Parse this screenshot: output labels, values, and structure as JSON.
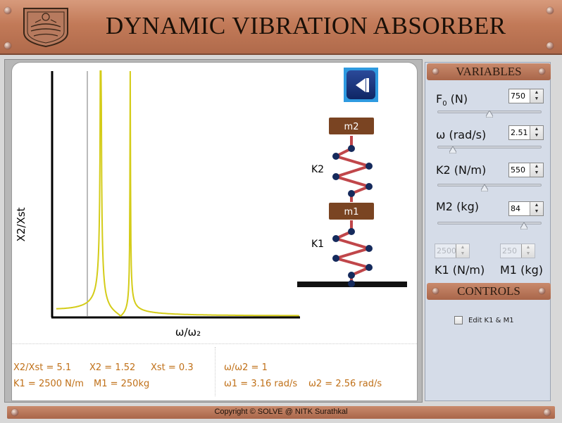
{
  "app": {
    "title": "DYNAMIC VIBRATION ABSORBER"
  },
  "plot": {
    "ylabel": "X2/Xst",
    "xlabel": "ω/ω₂"
  },
  "schematic": {
    "mass_top": "m2",
    "mass_bottom": "m1",
    "spring_top": "K2",
    "spring_bottom": "K1"
  },
  "readouts": {
    "ratio": "X2/Xst = 5.1",
    "x2": "X2 = 1.52",
    "xst": "Xst = 0.3",
    "k1": "K1 = 2500 N/m",
    "m1": "M1 = 250kg",
    "freq_ratio": "ω/ω2 = 1",
    "w1": "ω1 = 3.16 rad/s",
    "w2": "ω2 = 2.56 rad/s"
  },
  "variables": {
    "header": "VARIABLES",
    "f0": {
      "label_main": "F",
      "label_sub": "0",
      "label_unit": " (N)",
      "value": "750",
      "slider_fraction": 0.5
    },
    "omega": {
      "label": "ω (rad/s)",
      "value": "2.51",
      "slider_fraction": 0.15
    },
    "k2": {
      "label": "K2 (N/m)",
      "value": "550",
      "slider_fraction": 0.45
    },
    "m2": {
      "label": "M2 (kg)",
      "value": "84",
      "slider_fraction": 0.83
    },
    "k1": {
      "label": "K1 (N/m)",
      "value": "2500"
    },
    "m1": {
      "label": "M1 (kg)",
      "value": "250"
    }
  },
  "controls": {
    "header": "CONTROLS",
    "edit_label": "Edit K1 & M1",
    "edit_checked": false
  },
  "footer": {
    "text": "Copyright © SOLVE @ NITK Surathkal"
  },
  "colors": {
    "curve": "#d4cc18",
    "readout": "#c07018",
    "spring": "#c0464a",
    "mass": "#7a4422",
    "node": "#152a5c"
  }
}
